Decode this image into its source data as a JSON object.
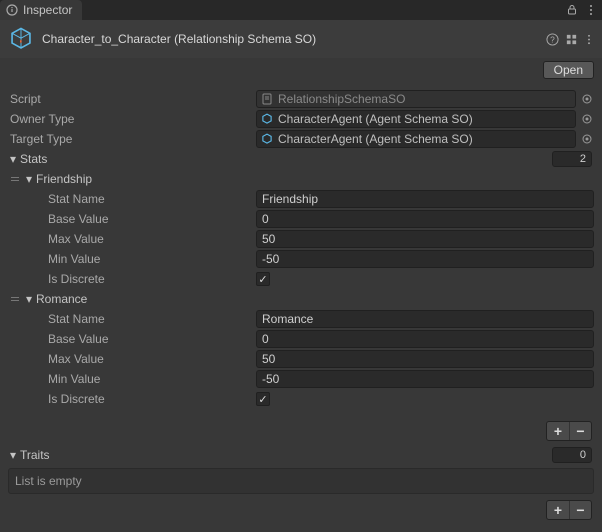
{
  "tab": {
    "title": "Inspector"
  },
  "header": {
    "title": "Character_to_Character (Relationship Schema SO)",
    "open_label": "Open"
  },
  "fields": {
    "script_label": "Script",
    "script_value": "RelationshipSchemaSO",
    "owner_label": "Owner Type",
    "owner_value": "CharacterAgent (Agent Schema SO)",
    "target_label": "Target Type",
    "target_value": "CharacterAgent (Agent Schema SO)"
  },
  "stats": {
    "header_label": "Stats",
    "count": "2",
    "prop_labels": {
      "stat_name": "Stat Name",
      "base_value": "Base Value",
      "max_value": "Max Value",
      "min_value": "Min Value",
      "is_discrete": "Is Discrete"
    },
    "items": [
      {
        "name": "Friendship",
        "base": "0",
        "max": "50",
        "min": "-50",
        "discrete": true
      },
      {
        "name": "Romance",
        "base": "0",
        "max": "50",
        "min": "-50",
        "discrete": true
      }
    ]
  },
  "traits": {
    "header_label": "Traits",
    "count": "0",
    "empty_text": "List is empty"
  }
}
